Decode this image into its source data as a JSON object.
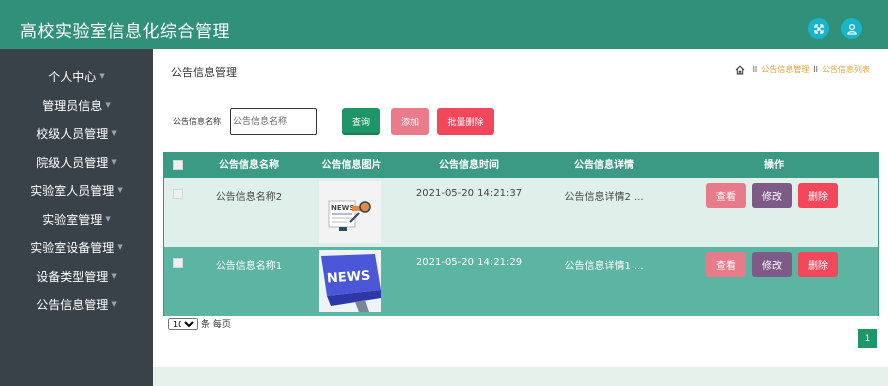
{
  "app": {
    "title": "高校实验室信息化综合管理"
  },
  "sidebar": {
    "items": [
      {
        "label": "个人中心"
      },
      {
        "label": "管理员信息"
      },
      {
        "label": "校级人员管理"
      },
      {
        "label": "院级人员管理"
      },
      {
        "label": "实验室人员管理"
      },
      {
        "label": "实验室管理"
      },
      {
        "label": "实验室设备管理"
      },
      {
        "label": "设备类型管理"
      },
      {
        "label": "公告信息管理"
      }
    ],
    "caret": "▼"
  },
  "page": {
    "title": "公告信息管理",
    "breadcrumb": {
      "separator": "II",
      "items": [
        "公告信息管理",
        "公告信息列表"
      ]
    }
  },
  "search": {
    "label": "公告信息名称",
    "placeholder": "公告信息名称",
    "value": ""
  },
  "buttons": {
    "query": "查询",
    "add": "添加",
    "batch_delete": "批量删除"
  },
  "table": {
    "columns": [
      "公告信息名称",
      "公告信息图片",
      "公告信息时间",
      "公告信息详情",
      "操作"
    ],
    "rows": [
      {
        "name": "公告信息名称2",
        "image": "news-illustration",
        "time": "2021-05-20 14:21:37",
        "detail": "公告信息详情2 ..."
      },
      {
        "name": "公告信息名称1",
        "image": "news-keyboard-key",
        "time": "2021-05-20 14:21:29",
        "detail": "公告信息详情1 ..."
      }
    ],
    "actions": {
      "view": "查看",
      "edit": "修改",
      "delete": "删除"
    }
  },
  "pagination": {
    "page_size": "10",
    "page_size_suffix": "条 每页",
    "current_page": "1"
  },
  "colors": {
    "header": "#31907a",
    "sidebar": "#394249",
    "accent_green": "#1e9667",
    "pink": "#ea7b8a",
    "red": "#f3475c",
    "purple": "#7e5b86"
  }
}
